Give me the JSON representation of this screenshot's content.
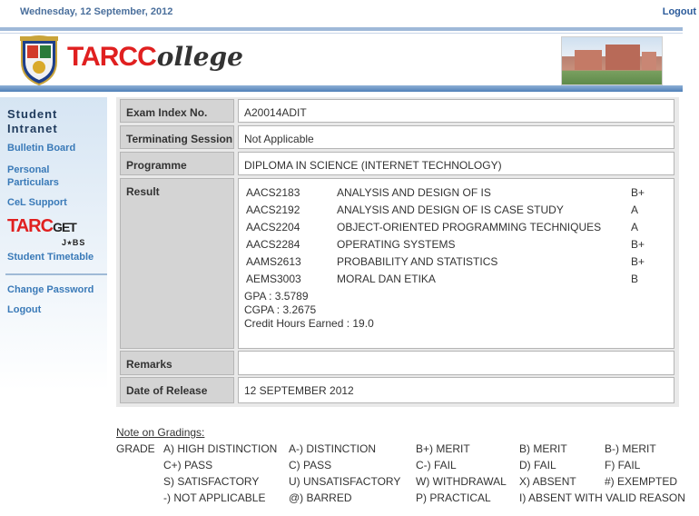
{
  "topbar": {
    "date": "Wednesday, 12 September, 2012",
    "logout": "Logout"
  },
  "header": {
    "brand_tarc": "TARC",
    "brand_college": "ollege",
    "campus_image": "campus-building-photo"
  },
  "sidebar": {
    "title_line1": "Student",
    "title_line2": "Intranet",
    "items": [
      {
        "label": "Bulletin Board"
      },
      {
        "label_line1": "Personal",
        "label_line2": "Particulars"
      },
      {
        "label": "CeL Support"
      },
      {
        "label": "Student Timetable"
      },
      {
        "label": "Change Password"
      },
      {
        "label": "Logout"
      }
    ],
    "tarcget": {
      "tarc": "TARC",
      "get": "GET",
      "jobs": "J⭑BS"
    }
  },
  "record": {
    "exam_index": {
      "label": "Exam Index No.",
      "value": "A20014ADIT"
    },
    "terminating": {
      "label": "Terminating Session",
      "value": "Not Applicable"
    },
    "programme": {
      "label": "Programme",
      "value": "DIPLOMA IN SCIENCE (INTERNET TECHNOLOGY)"
    },
    "result": {
      "label": "Result",
      "courses": [
        {
          "code": "AACS2183",
          "name": "ANALYSIS AND DESIGN OF IS",
          "grade": "B+"
        },
        {
          "code": "AACS2192",
          "name": "ANALYSIS AND DESIGN OF IS CASE STUDY",
          "grade": "A"
        },
        {
          "code": "AACS2204",
          "name": "OBJECT-ORIENTED PROGRAMMING TECHNIQUES",
          "grade": "A"
        },
        {
          "code": "AACS2284",
          "name": "OPERATING SYSTEMS",
          "grade": "B+"
        },
        {
          "code": "AAMS2613",
          "name": "PROBABILITY AND STATISTICS",
          "grade": "B+"
        },
        {
          "code": "AEMS3003",
          "name": "MORAL DAN ETIKA",
          "grade": "B"
        }
      ],
      "gpa": "GPA : 3.5789",
      "cgpa": "CGPA : 3.2675",
      "credit": "Credit Hours Earned : 19.0"
    },
    "remarks": {
      "label": "Remarks",
      "value": ""
    },
    "release": {
      "label": "Date of Release",
      "value": "12 SEPTEMBER 2012"
    }
  },
  "notes": {
    "heading": "Note on Gradings:",
    "grade_label": "GRADE",
    "rows": [
      [
        "A) HIGH DISTINCTION",
        "A-) DISTINCTION",
        "B+) MERIT",
        "B) MERIT",
        "B-) MERIT"
      ],
      [
        "C+) PASS",
        "C) PASS",
        "C-) FAIL",
        "D) FAIL",
        "F) FAIL"
      ],
      [
        "S) SATISFACTORY",
        "U) UNSATISFACTORY",
        "W) WITHDRAWAL",
        "X) ABSENT",
        "#) EXEMPTED"
      ],
      [
        "-) NOT APPLICABLE",
        "@) BARRED",
        "P) PRACTICAL",
        "I) ABSENT WITH VALID REASON",
        ""
      ]
    ]
  },
  "colors": {
    "accent": "#3a7ab8",
    "brand_red": "#e02020",
    "header_band": "#4f7fb8"
  }
}
